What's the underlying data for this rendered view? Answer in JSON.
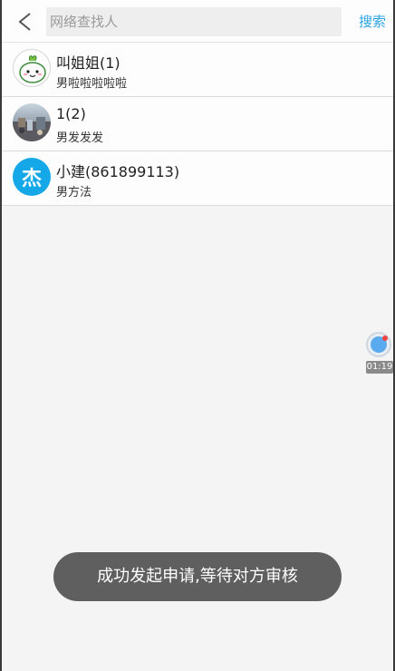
{
  "header": {
    "back_icon": "chevron-left-icon",
    "search_placeholder": "网络查找人",
    "search_value": "",
    "search_button": "搜索",
    "accent_color": "#2aa3e6"
  },
  "results": [
    {
      "name": "叫姐姐(1)",
      "subtitle": "男啦啦啦啦啦",
      "avatar": "cartoon-avatar"
    },
    {
      "name": "1(2)",
      "subtitle": "男发发发",
      "avatar": "photo-avatar"
    },
    {
      "name": "小建(861899113)",
      "subtitle": "男方法",
      "avatar": "letter-avatar",
      "avatar_text": "杰",
      "avatar_color": "#14a8e8"
    }
  ],
  "floating_recorder": {
    "icon": "record-icon",
    "time": "01:19"
  },
  "toast": {
    "message": "成功发起申请,等待对方审核"
  }
}
